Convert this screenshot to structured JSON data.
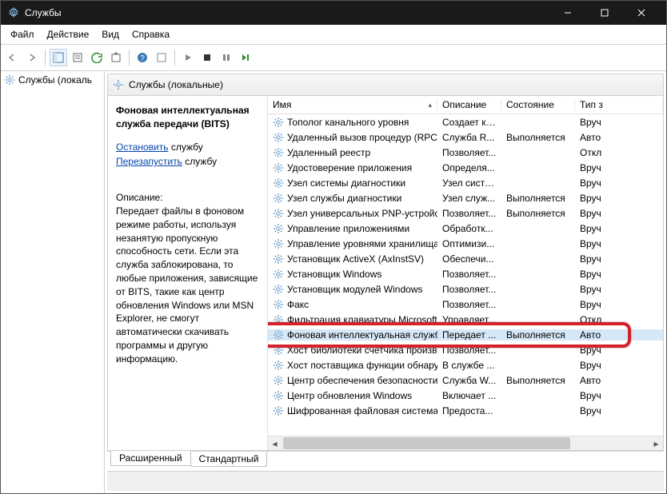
{
  "title": "Службы",
  "menu": [
    "Файл",
    "Действие",
    "Вид",
    "Справка"
  ],
  "tree_root": "Службы (локаль",
  "main_head": "Службы (локальные)",
  "detail": {
    "name": "Фоновая интеллектуальная служба передачи (BITS)",
    "stop_link": "Остановить",
    "stop_suffix": " службу",
    "restart_link": "Перезапустить",
    "restart_suffix": " службу",
    "desc_label": "Описание:",
    "desc_text": "Передает файлы в фоновом режиме работы, используя незанятую пропускную способность сети. Если эта служба заблокирована, то любые приложения, зависящие от BITS, такие как центр обновления Windows или MSN Explorer, не смогут автоматически скачивать программы и другую информацию."
  },
  "columns": {
    "name": "Имя",
    "desc": "Описание",
    "state": "Состояние",
    "startup": "Тип з"
  },
  "services": [
    {
      "name": "Тополог канального уровня",
      "desc": "Создает ка...",
      "state": "",
      "startup": "Вруч"
    },
    {
      "name": "Удаленный вызов процедур (RPC)",
      "desc": "Служба R...",
      "state": "Выполняется",
      "startup": "Авто"
    },
    {
      "name": "Удаленный реестр",
      "desc": "Позволяет...",
      "state": "",
      "startup": "Откл"
    },
    {
      "name": "Удостоверение приложения",
      "desc": "Определя...",
      "state": "",
      "startup": "Вруч"
    },
    {
      "name": "Узел системы диагностики",
      "desc": "Узел систе...",
      "state": "",
      "startup": "Вруч"
    },
    {
      "name": "Узел службы диагностики",
      "desc": "Узел служ...",
      "state": "Выполняется",
      "startup": "Вруч"
    },
    {
      "name": "Узел универсальных PNP-устройств",
      "desc": "Позволяет...",
      "state": "Выполняется",
      "startup": "Вруч"
    },
    {
      "name": "Управление приложениями",
      "desc": "Обработк...",
      "state": "",
      "startup": "Вруч"
    },
    {
      "name": "Управление уровнями хранилища",
      "desc": "Оптимизи...",
      "state": "",
      "startup": "Вруч"
    },
    {
      "name": "Установщик ActiveX (AxInstSV)",
      "desc": "Обеспечи...",
      "state": "",
      "startup": "Вруч"
    },
    {
      "name": "Установщик Windows",
      "desc": "Позволяет...",
      "state": "",
      "startup": "Вруч"
    },
    {
      "name": "Установщик модулей Windows",
      "desc": "Позволяет...",
      "state": "",
      "startup": "Вруч"
    },
    {
      "name": "Факс",
      "desc": "Позволяет...",
      "state": "",
      "startup": "Вруч"
    },
    {
      "name": "Фильтрация клавиатуры Microsoft",
      "desc": "Управляет...",
      "state": "",
      "startup": "Откл"
    },
    {
      "name": "Фоновая интеллектуальная служба п...",
      "desc": "Передает ...",
      "state": "Выполняется",
      "startup": "Авто",
      "selected": true
    },
    {
      "name": "Хост библиотеки счетчика производи...",
      "desc": "Позволяет...",
      "state": "",
      "startup": "Вруч"
    },
    {
      "name": "Хост поставщика функции обнаруже...",
      "desc": "В службе ...",
      "state": "",
      "startup": "Вруч"
    },
    {
      "name": "Центр обеспечения безопасности",
      "desc": "Служба W...",
      "state": "Выполняется",
      "startup": "Авто"
    },
    {
      "name": "Центр обновления Windows",
      "desc": "Включает ...",
      "state": "",
      "startup": "Вруч"
    },
    {
      "name": "Шифрованная файловая система (EFS)",
      "desc": "Предоста...",
      "state": "",
      "startup": "Вруч"
    }
  ],
  "tabs": {
    "extended": "Расширенный",
    "standard": "Стандартный"
  }
}
